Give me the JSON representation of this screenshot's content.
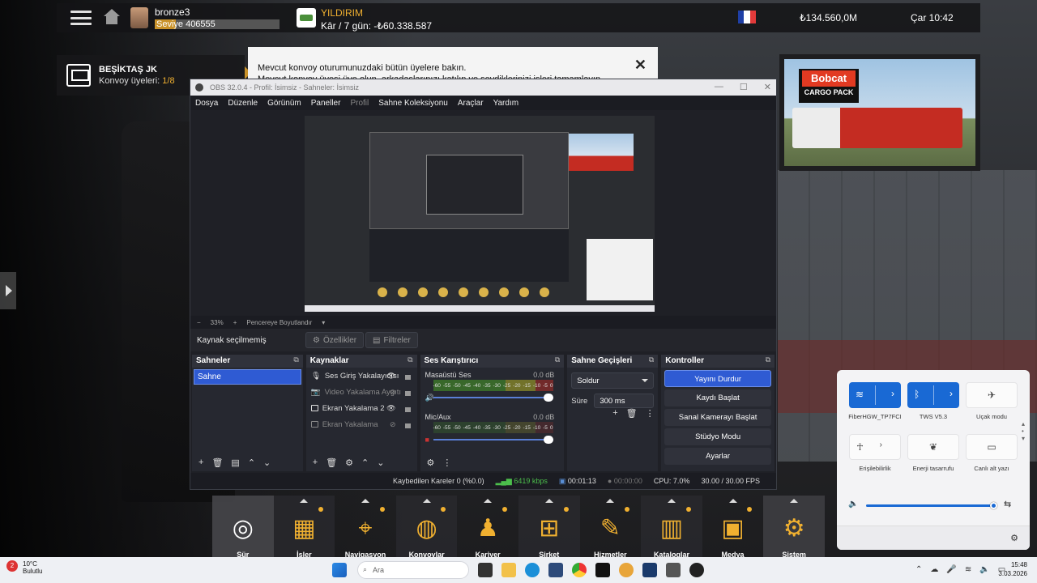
{
  "topbar": {
    "player_name": "bronze3",
    "level_text": "Seviye 406555",
    "level_progress": 0.17,
    "company_name": "YILDIRIM",
    "company_profit": "Kâr / 7 gün: -₺60.338.587",
    "money": "₺134.560,0M",
    "clock": "Çar 10:42",
    "flag_colors": [
      "#1f3fa6",
      "#ffffff",
      "#e23a3a"
    ]
  },
  "convoy": {
    "name": "BEŞİKTAŞ JK",
    "members_label": "Konvoy üyeleri:",
    "members_count": "1/8"
  },
  "notification": {
    "line1": "Mevcut konvoy oturumunuzdaki bütün üyelere bakın.",
    "line2": "Mevcut konvoy üyesi üye olun, arkadaşlarınızı katılın ve sevdiklerinizi işleri tamamlayın.",
    "close": "✕"
  },
  "banner": {
    "brand": "Bobcat",
    "subtitle": "CARGO PACK"
  },
  "obs": {
    "title": "OBS 32.0.4 - Profil: İsimsiz - Sahneler: İsimsiz",
    "window_controls": [
      "—",
      "☐",
      "✕"
    ],
    "menu": [
      "Dosya",
      "Düzenle",
      "Görünüm",
      "Paneller",
      "Profil",
      "Sahne Koleksiyonu",
      "Araçlar",
      "Yardım"
    ],
    "zoom_minus": "−",
    "zoom_level": "33%",
    "zoom_plus": "+",
    "zoom_fit": "Pencereye Boyutlandır",
    "source_status": "Kaynak seçilmemiş",
    "properties_button": "Özellikler",
    "filters_button": "Filtreler",
    "scenes": {
      "title": "Sahneler",
      "items": [
        "Sahne"
      ]
    },
    "sources": {
      "title": "Kaynaklar",
      "items": [
        {
          "label": "Ses Giriş Yakalayıcısı",
          "visible": true
        },
        {
          "label": "Video Yakalama Aygıtı",
          "visible": false
        },
        {
          "label": "Ekran Yakalama 2",
          "visible": true
        },
        {
          "label": "Ekran Yakalama",
          "visible": false
        }
      ]
    },
    "mixer": {
      "title": "Ses Karıştırıcı",
      "ticks": [
        "-60",
        "-55",
        "-50",
        "-45",
        "-40",
        "-35",
        "-30",
        "-25",
        "-20",
        "-15",
        "-10",
        "-5",
        "0"
      ],
      "channels": [
        {
          "name": "Masaüstü Ses",
          "db": "0.0 dB",
          "muted": false
        },
        {
          "name": "Mic/Aux",
          "db": "0.0 dB",
          "muted": true
        }
      ]
    },
    "transitions": {
      "title": "Sahne Geçişleri",
      "selected": "Soldur",
      "duration_label": "Süre",
      "duration_value": "300 ms"
    },
    "controls": {
      "title": "Kontroller",
      "buttons": [
        "Yayını Durdur",
        "Kaydı Başlat",
        "Sanal Kamerayı Başlat",
        "Stüdyo Modu",
        "Ayarlar"
      ]
    },
    "status": {
      "dropped": "Kaybedilen Kareler 0 (%0.0)",
      "bitrate": "6419 kbps",
      "stream_time": "00:01:13",
      "rec_time": "00:00:00",
      "cpu": "CPU: 7.0%",
      "fps": "30.00 / 30.00 FPS"
    }
  },
  "game_menu": {
    "items": [
      {
        "label": "Sür",
        "icon": "steering-wheel-icon",
        "glyph": "◎"
      },
      {
        "label": "İşler",
        "icon": "jobs-icon",
        "glyph": "▦"
      },
      {
        "label": "Navigasyon",
        "icon": "map-pin-icon",
        "glyph": "⌖"
      },
      {
        "label": "Konvoylar",
        "icon": "globe-icon",
        "glyph": "◍"
      },
      {
        "label": "Kariyer",
        "icon": "person-icon",
        "glyph": "♟"
      },
      {
        "label": "Şirket",
        "icon": "truck-front-icon",
        "glyph": "⊞"
      },
      {
        "label": "Hizmetler",
        "icon": "service-icon",
        "glyph": "✎"
      },
      {
        "label": "Kataloglar",
        "icon": "books-icon",
        "glyph": "▥"
      },
      {
        "label": "Medya",
        "icon": "media-icon",
        "glyph": "▣"
      },
      {
        "label": "Sistem",
        "icon": "gear-icon",
        "glyph": "⚙"
      }
    ]
  },
  "quick_settings": {
    "tiles": [
      {
        "label": "FiberHGW_TP7FCI",
        "icon": "wifi-icon",
        "glyph": "≋",
        "on": true,
        "chevron": true
      },
      {
        "label": "TWS V5.3",
        "icon": "bluetooth-icon",
        "glyph": "ᛒ",
        "on": true,
        "chevron": true
      },
      {
        "label": "Uçak modu",
        "icon": "airplane-icon",
        "glyph": "✈",
        "on": false,
        "chevron": false
      },
      {
        "label": "Erişilebilirlik",
        "icon": "accessibility-icon",
        "glyph": "☥",
        "on": false,
        "chevron": true
      },
      {
        "label": "Enerji tasarrufu",
        "icon": "leaf-icon",
        "glyph": "❦",
        "on": false,
        "chevron": false
      },
      {
        "label": "Canlı alt yazı",
        "icon": "captions-icon",
        "glyph": "▭",
        "on": false,
        "chevron": false
      }
    ],
    "volume": 1.0
  },
  "taskbar": {
    "weather_badge": "2",
    "weather_temp": "10°C",
    "weather_desc": "Bulutlu",
    "search_placeholder": "Ara",
    "time": "15:48",
    "date": "3.03.2026"
  }
}
